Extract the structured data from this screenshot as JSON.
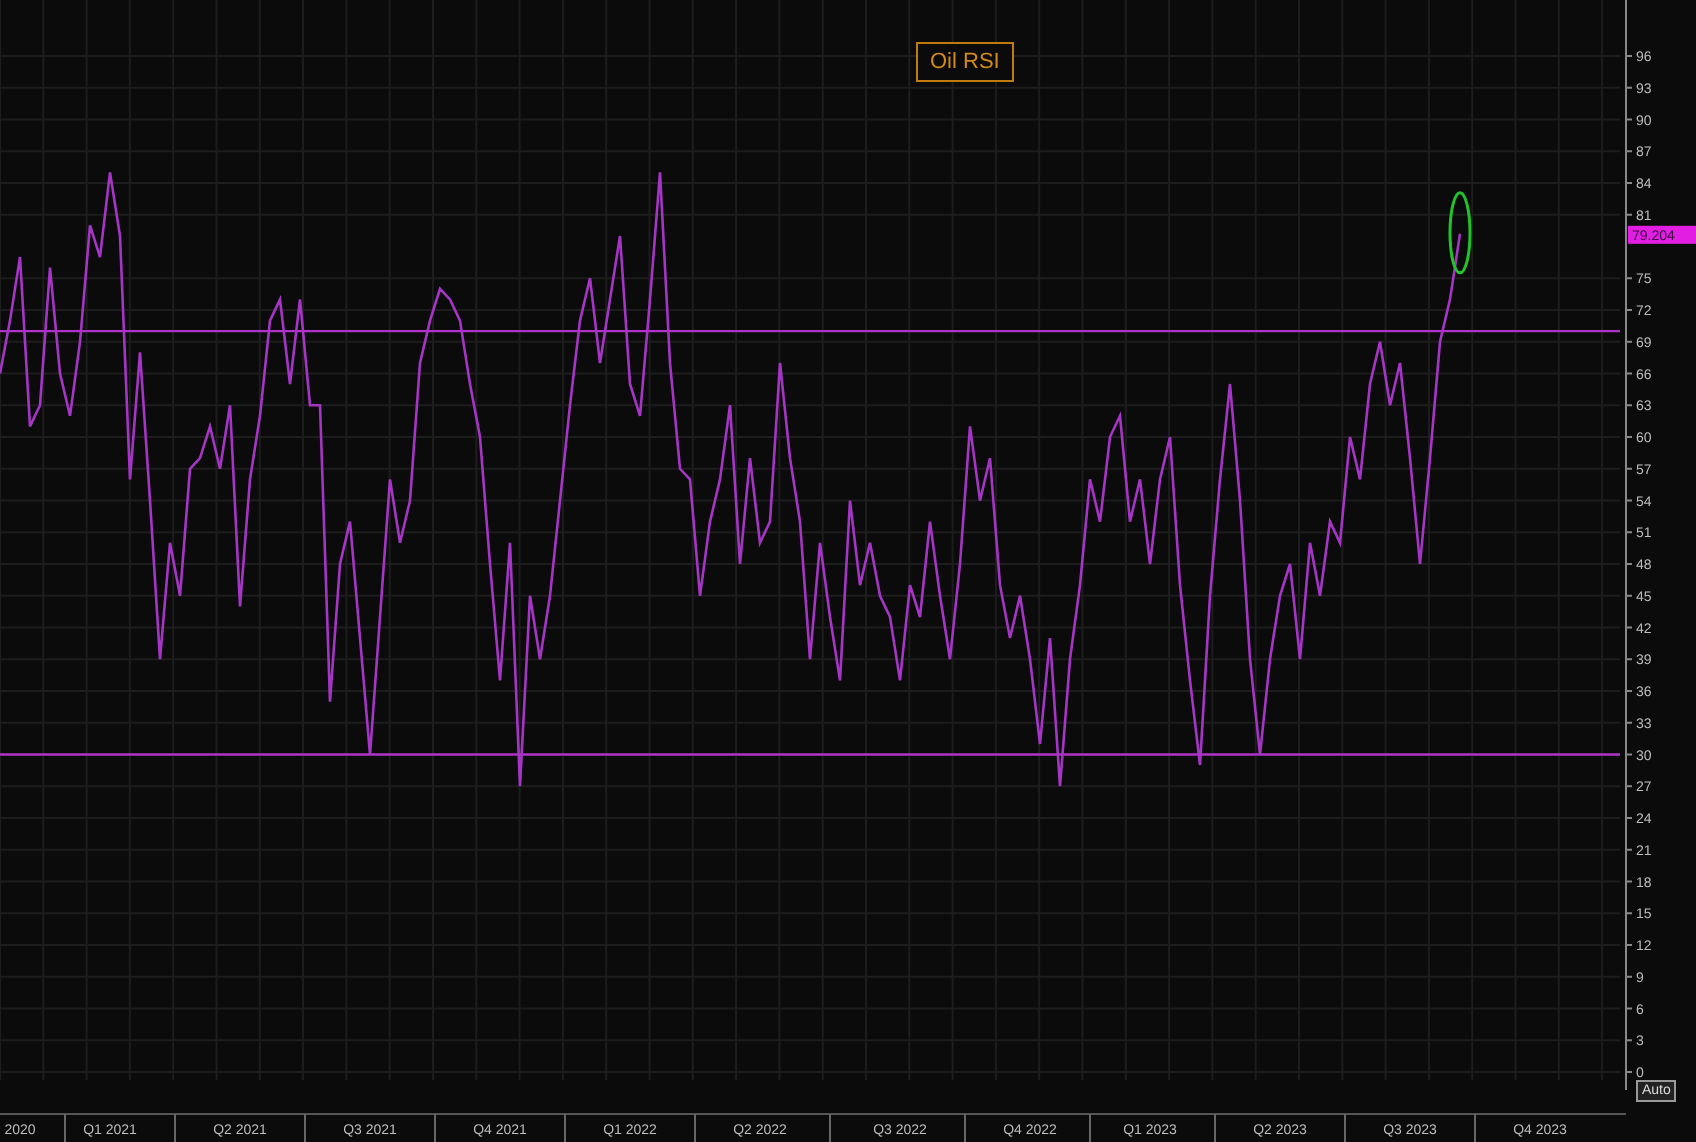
{
  "chart": {
    "last_value": "79.204",
    "auto_button": "Auto",
    "highlight": {
      "color": "#22c32a"
    },
    "chart_data": {
      "type": "line",
      "title": "Oil RSI",
      "grid": true,
      "ylim": [
        0,
        96
      ],
      "yticks": [
        0,
        3,
        6,
        9,
        12,
        15,
        18,
        21,
        24,
        27,
        30,
        33,
        36,
        39,
        42,
        45,
        48,
        51,
        54,
        57,
        60,
        63,
        66,
        69,
        72,
        75,
        81,
        84,
        87,
        90,
        93,
        96
      ],
      "categories": [
        null,
        null,
        "2020",
        null,
        null,
        null,
        null,
        null,
        null,
        null,
        null,
        "Q1 2021",
        null,
        null,
        null,
        null,
        null,
        null,
        null,
        null,
        null,
        null,
        null,
        null,
        "Q2 2021",
        null,
        null,
        null,
        null,
        null,
        null,
        null,
        null,
        null,
        null,
        null,
        null,
        "Q3 2021",
        null,
        null,
        null,
        null,
        null,
        null,
        null,
        null,
        null,
        null,
        null,
        null,
        "Q4 2021",
        null,
        null,
        null,
        null,
        null,
        null,
        null,
        null,
        null,
        null,
        null,
        null,
        "Q1 2022",
        null,
        null,
        null,
        null,
        null,
        null,
        null,
        null,
        null,
        null,
        null,
        null,
        "Q2 2022",
        null,
        null,
        null,
        null,
        null,
        null,
        null,
        null,
        null,
        null,
        null,
        null,
        null,
        "Q3 2022",
        null,
        null,
        null,
        null,
        null,
        null,
        null,
        null,
        null,
        null,
        null,
        null,
        "Q4 2022",
        null,
        null,
        null,
        null,
        null,
        null,
        null,
        null,
        null,
        null,
        null,
        "Q1 2023",
        null,
        null,
        null,
        null,
        null,
        null,
        null,
        null,
        null,
        null,
        null,
        null,
        "Q2 2023",
        null,
        null,
        null,
        null,
        null,
        null,
        null,
        null,
        null,
        null,
        null,
        null,
        "Q3 2023",
        null,
        null,
        null,
        null,
        null,
        null,
        null,
        null,
        null,
        null,
        null,
        null,
        "Q4 2023",
        null,
        null,
        null,
        null,
        null,
        null,
        null,
        null
      ],
      "series": [
        {
          "color": "#a535c4",
          "values": [
            66,
            71,
            77,
            61,
            63,
            76,
            66,
            62,
            69,
            80,
            77,
            85,
            79,
            56,
            68,
            54,
            39,
            50,
            45,
            57,
            58,
            61,
            57,
            63,
            44,
            56,
            62,
            71,
            73,
            65,
            73,
            63,
            63,
            35,
            48,
            52,
            41,
            30,
            43,
            56,
            50,
            54,
            67,
            71,
            74,
            73,
            71,
            65,
            60,
            48,
            37,
            50,
            27,
            45,
            39,
            45,
            54,
            63,
            71,
            75,
            67,
            73,
            79,
            65,
            62,
            73,
            85,
            67,
            57,
            56,
            45,
            52,
            56,
            63,
            48,
            58,
            50,
            52,
            67,
            58,
            52,
            39,
            50,
            43,
            37,
            54,
            46,
            50,
            45,
            43,
            37,
            46,
            43,
            52,
            45,
            39,
            48,
            61,
            54,
            58,
            46,
            41,
            45,
            39,
            31,
            41,
            27,
            39,
            46,
            56,
            52,
            60,
            62,
            52,
            56,
            48,
            56,
            60,
            46,
            37,
            29,
            45,
            56,
            65,
            54,
            39,
            30,
            39,
            45,
            48,
            39,
            50,
            45,
            52,
            50,
            60,
            56,
            65,
            69,
            63,
            67,
            58,
            48,
            58,
            69,
            73,
            79.2,
            null,
            null,
            null,
            null,
            null,
            null,
            null,
            null,
            null,
            null,
            null,
            null,
            null,
            null,
            null,
            null
          ]
        }
      ],
      "ref_lines": [
        {
          "axis": "y",
          "value": 70,
          "color": "#b032c8"
        },
        {
          "axis": "y",
          "value": 30,
          "color": "#b032c8"
        }
      ]
    }
  }
}
